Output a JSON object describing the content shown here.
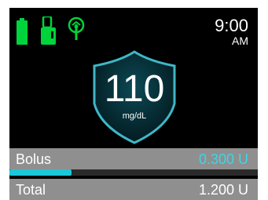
{
  "status": {
    "battery_icon": "battery-full-icon",
    "cartridge_icon": "cartridge-icon",
    "signal_icon": "cgm-signal-icon",
    "icon_color": "#00d43c",
    "time": "9:00",
    "ampm": "AM"
  },
  "glucose": {
    "value": "110",
    "unit": "mg/dL",
    "shield_color": "#3fb7c6"
  },
  "bolus": {
    "label": "Bolus",
    "value": "0.300  U",
    "progress": 0.25,
    "accent": "#3cd6e6"
  },
  "total": {
    "label": "Total",
    "value": "1.200  U"
  }
}
